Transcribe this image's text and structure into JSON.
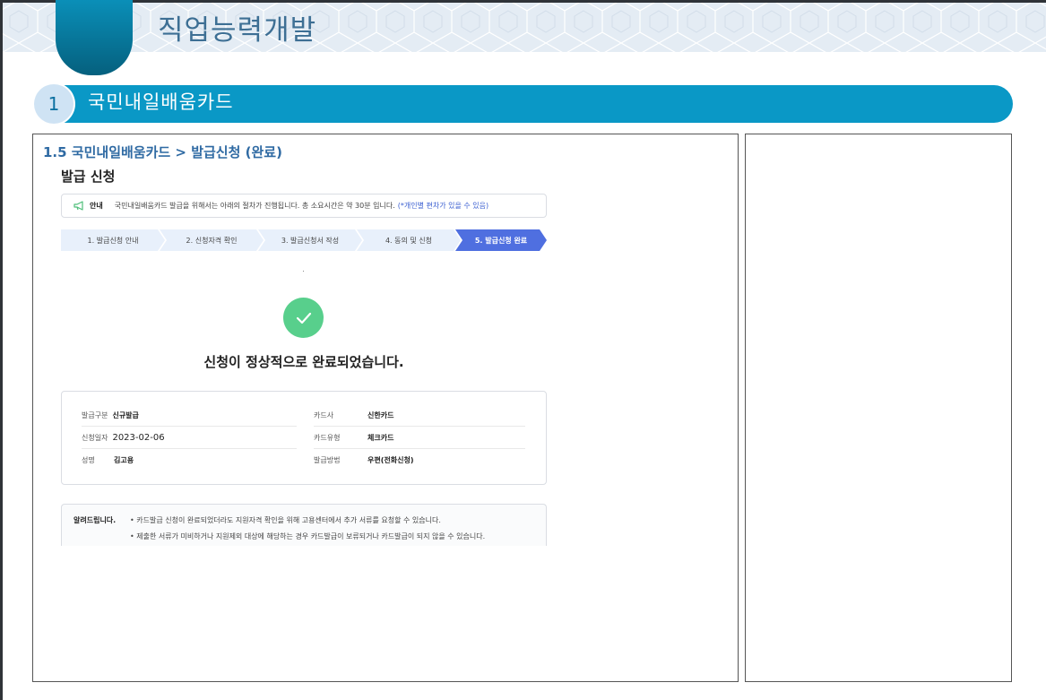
{
  "header": {
    "title": "직업능력개발"
  },
  "section": {
    "number": "1",
    "title": "국민내일배움카드"
  },
  "breadcrumb": "1.5 국민내일배움카드 > 발급신청 (완료)",
  "subtitle": "발급 신청",
  "notice": {
    "icon": "megaphone-icon",
    "label": "안내",
    "text": "국민내일배움카드 발급을 위해서는 아래의 절차가 진행됩니다. 총 소요시간은 약 30분 입니다.",
    "highlight": "(*개인별 편차가 있을 수 있음)"
  },
  "steps": [
    {
      "label": "1. 발급신청 안내"
    },
    {
      "label": "2. 신청자격 확인"
    },
    {
      "label": "3. 발급신청서 작성"
    },
    {
      "label": "4. 동의 및 신청"
    },
    {
      "label": "5. 발급신청 완료",
      "active": true
    }
  ],
  "completion": {
    "icon": "check-circle-icon",
    "message": "신청이 정상적으로 완료되었습니다."
  },
  "info": {
    "issue_type": {
      "label": "발급구분",
      "value": "신규발급"
    },
    "card_company": {
      "label": "카드사",
      "value": "신한카드"
    },
    "apply_date": {
      "label": "신청일자",
      "value": "2023-02-06"
    },
    "card_type": {
      "label": "카드유형",
      "value": "체크카드"
    },
    "name": {
      "label": "성명",
      "value": "김고용"
    },
    "issue_method": {
      "label": "발급방법",
      "value": "우편(전화신청)"
    }
  },
  "alert": {
    "title": "알려드립니다.",
    "items": [
      "• 카드발급 신청이 완료되었더라도 지원자격 확인을 위해 고용센터에서 추가 서류를 요청할 수 있습니다.",
      "• 제출한 서류가 미비하거나 지원제외 대상에 해당하는 경우 카드발급이 보류되거나 카드발급이 되지 않을 수 있습니다."
    ]
  },
  "colors": {
    "section_bar": "#0a98c6",
    "breadcrumb": "#2f6aa3",
    "active_step": "#4f6fe0",
    "check": "#58cf8c"
  }
}
